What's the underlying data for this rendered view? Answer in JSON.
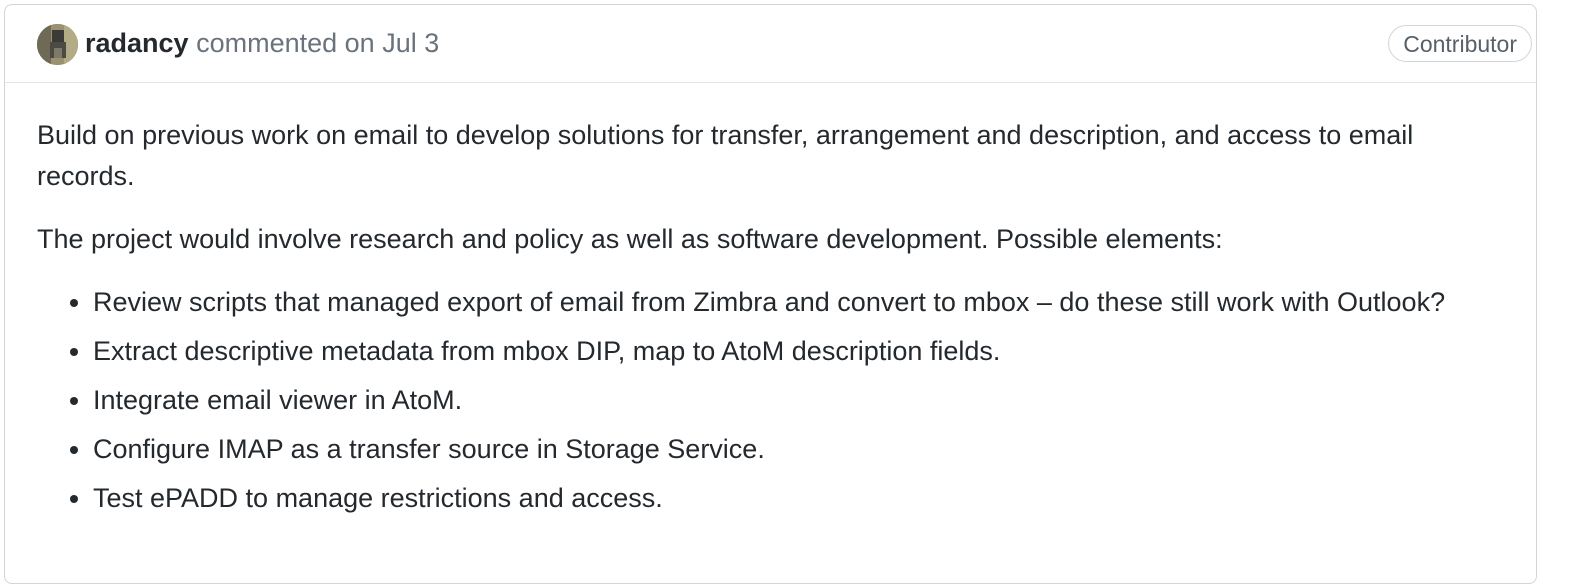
{
  "comment": {
    "author": "radancy",
    "action": "commented on",
    "date": "Jul 3",
    "badge": "Contributor",
    "paragraphs": [
      "Build on previous work on email to develop solutions for transfer, arrangement and description, and access to email records.",
      "The project would involve research and policy as well as software development. Possible elements:"
    ],
    "list_items": [
      "Review scripts that managed export of email from Zimbra and convert to mbox – do these still work with Outlook?",
      "Extract descriptive metadata from mbox DIP, map to AtoM description fields.",
      "Integrate email viewer in AtoM.",
      "Configure IMAP as a transfer source in Storage Service.",
      "Test ePADD to manage restrictions and access."
    ]
  }
}
